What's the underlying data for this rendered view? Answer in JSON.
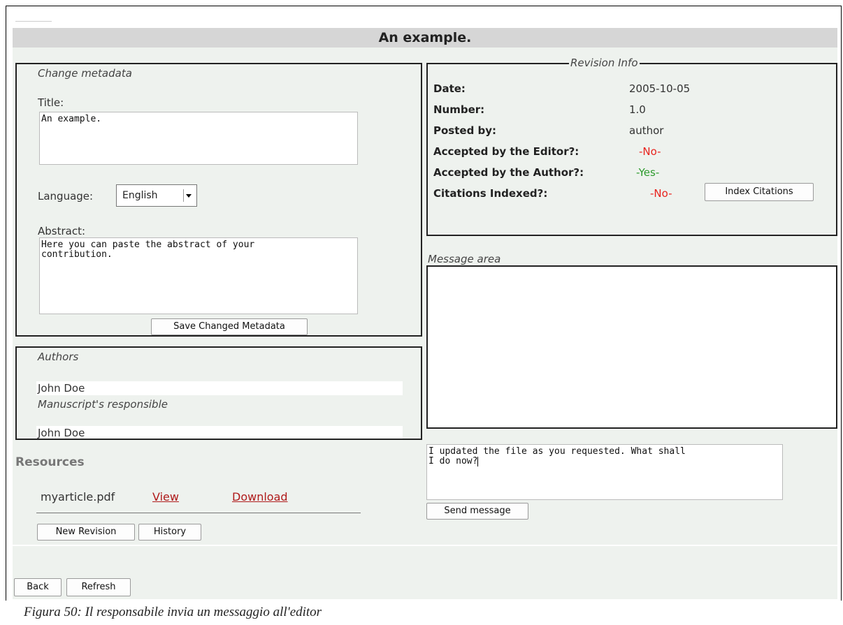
{
  "page_title": "An example.",
  "metadata": {
    "legend": "Change metadata",
    "title_label": "Title:",
    "title_value": "An example.",
    "language_label": "Language:",
    "language_value": "English",
    "abstract_label": "Abstract:",
    "abstract_value": "Here you can paste the abstract of your\ncontribution.",
    "save_button": "Save Changed Metadata"
  },
  "authors": {
    "legend": "Authors",
    "author_name": "John Doe",
    "responsible_label": "Manuscript's responsible",
    "responsible_name": "John Doe"
  },
  "resources": {
    "heading": "Resources",
    "file_name": "myarticle.pdf",
    "view_link": "View",
    "download_link": "Download",
    "new_revision_button": "New Revision",
    "history_button": "History"
  },
  "revision_info": {
    "legend": "Revision Info",
    "rows": [
      {
        "label": "Date:",
        "value": "2005-10-05"
      },
      {
        "label": "Number:",
        "value": "1.0"
      },
      {
        "label": "Posted by:",
        "value": "author"
      },
      {
        "label": "Accepted by the Editor?:",
        "value": "-No-",
        "status_color": "#e8231d"
      },
      {
        "label": "Accepted by the Author?:",
        "value": "-Yes-",
        "status_color": "#2c9a2c"
      },
      {
        "label": "Citations Indexed?:",
        "value": "-No-",
        "status_color": "#e8231d"
      }
    ],
    "index_button": "Index Citations"
  },
  "messages": {
    "area_label": "Message area",
    "input_value": "I updated the file as you requested. What shall\nI do now?",
    "send_button": "Send message"
  },
  "nav": {
    "back_button": "Back",
    "refresh_button": "Refresh"
  },
  "caption": "Figura 50: Il responsabile invia un messaggio all'editor"
}
